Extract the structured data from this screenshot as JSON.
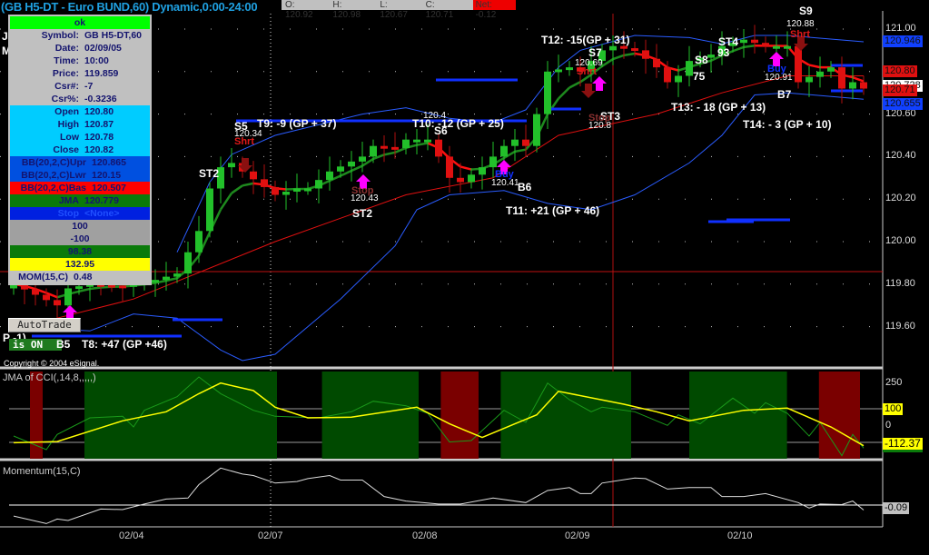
{
  "header": {
    "title": "(GB H5-DT - Euro BUND,60) Dynamic,0:00-24:00",
    "open": "O: 120.92",
    "high": "H: 120.98",
    "low": "L: 120.67",
    "close": "C: 120.71",
    "net": "Net: -0.12"
  },
  "data_window": {
    "ok": "ok",
    "rows": [
      {
        "k": "Symbol:",
        "v": "GB H5-DT,60"
      },
      {
        "k": "Date:",
        "v": "02/09/05"
      },
      {
        "k": "Time:",
        "v": "10:00"
      },
      {
        "k": "Price:",
        "v": "119.859"
      },
      {
        "k": "Csr#:",
        "v": "-7"
      },
      {
        "k": "Csr%:",
        "v": "-0.3236"
      },
      {
        "k": "Open",
        "v": "120.80"
      },
      {
        "k": "High",
        "v": "120.87"
      },
      {
        "k": "Low",
        "v": "120.78"
      },
      {
        "k": "Close",
        "v": "120.82"
      },
      {
        "k": "BB(20,2,C)Upr",
        "v": "120.865"
      },
      {
        "k": "BB(20,2,C)Lwr",
        "v": "120.15"
      },
      {
        "k": "BB(20,2,C)Bas",
        "v": "120.507"
      },
      {
        "k": "JMA",
        "v": "120.779"
      },
      {
        "k": "Stop",
        "v": "<None>"
      },
      {
        "k": "",
        "v": "100"
      },
      {
        "k": "",
        "v": "-100"
      },
      {
        "k": "",
        "v": "98.38"
      },
      {
        "k": "",
        "v": "132.95"
      },
      {
        "k": "MOM(15,C)",
        "v": "0.48"
      }
    ]
  },
  "left_labels": {
    "j": "J",
    "m": "M",
    "p": "P -1)",
    "autotrade": "AutoTrade",
    "is_on": "is ON",
    "copyright": "Copyright © 2004 eSignal."
  },
  "annotations": [
    "S5",
    "120.34",
    "T9: -9 (GP + 37)",
    "ST2",
    "T10: -12 (GP + 25)",
    "S6",
    "120.4",
    "120.43",
    "ST2",
    "120.41",
    "B6",
    "T11: +21 (GP + 46)",
    "T12: -15(GP + 31)",
    "S7",
    "120.69",
    "ST3",
    "120.8",
    "S8",
    "75",
    "ST4",
    "93",
    "T13: - 18 (GP + 13)",
    "120.91",
    "B7",
    "T14: - 3 (GP + 10)",
    "S9",
    "120.88",
    "B5",
    "T8: +47 (GP +46)"
  ],
  "signals": {
    "short": "Shrt",
    "stop": "Stop",
    "buy": "Buy"
  },
  "price_axis": {
    "ticks": [
      "121.00",
      "120.80",
      "120.60",
      "120.40",
      "120.20",
      "120.00",
      "119.80",
      "119.60"
    ],
    "tags": {
      "upper": "120.946",
      "mid": "120.80",
      "last": "120.71",
      "lower": "120.655",
      "cur": "120.728"
    }
  },
  "cci_panel": {
    "title": "JMA of CCI(,14,8,,,,,)",
    "ticks": [
      "250",
      "100",
      "0"
    ],
    "tag_100": "100",
    "value": "-112.37"
  },
  "mom_panel": {
    "title": "Momentum(15,C)",
    "value": "-0.09"
  },
  "dates": [
    "02/04",
    "02/07",
    "02/08",
    "02/09",
    "02/10"
  ],
  "colors": {
    "up": "#22c02a",
    "down": "#e01010",
    "band": "#2255ff",
    "jma_up": "#1e8a1e",
    "jma_down": "#ff1010",
    "cci_green": "#004a00",
    "cci_red": "#7a0000"
  },
  "chart_data": [
    {
      "type": "candlestick",
      "title": "GB H5-DT - Euro BUND,60",
      "ylim": [
        119.4,
        121.06
      ],
      "closes": [
        [
          0,
          119.8
        ],
        [
          2,
          119.75
        ],
        [
          4,
          119.7
        ],
        [
          5,
          119.78
        ],
        [
          7,
          119.8
        ],
        [
          10,
          119.79
        ],
        [
          13,
          119.82
        ],
        [
          15,
          119.85
        ],
        [
          17,
          120.05
        ],
        [
          18,
          120.25
        ],
        [
          19,
          120.35
        ],
        [
          20,
          120.37
        ],
        [
          21,
          120.33
        ],
        [
          24,
          120.22
        ],
        [
          26,
          120.25
        ],
        [
          27,
          120.25
        ],
        [
          29,
          120.33
        ],
        [
          32,
          120.4
        ],
        [
          33,
          120.45
        ],
        [
          35,
          120.44
        ],
        [
          36,
          120.48
        ],
        [
          38,
          120.48
        ],
        [
          39,
          120.4
        ],
        [
          40,
          120.3
        ],
        [
          41,
          120.28
        ],
        [
          43,
          120.35
        ],
        [
          45,
          120.45
        ],
        [
          46,
          120.48
        ],
        [
          47,
          120.45
        ],
        [
          48,
          120.6
        ],
        [
          49,
          120.8
        ],
        [
          51,
          120.82
        ],
        [
          52,
          120.8
        ],
        [
          54,
          120.9
        ],
        [
          55,
          120.92
        ],
        [
          57,
          120.9
        ],
        [
          59,
          120.82
        ],
        [
          60,
          120.75
        ],
        [
          61,
          120.78
        ],
        [
          62,
          120.85
        ],
        [
          64,
          120.88
        ],
        [
          65,
          120.92
        ],
        [
          67,
          120.95
        ],
        [
          69,
          120.92
        ],
        [
          71,
          120.92
        ],
        [
          72,
          120.75
        ],
        [
          74,
          120.8
        ],
        [
          75,
          120.82
        ],
        [
          76,
          120.72
        ],
        [
          77,
          120.75
        ],
        [
          78,
          120.72
        ]
      ],
      "bb_upper": [
        [
          15,
          119.95
        ],
        [
          18,
          120.28
        ],
        [
          20,
          120.41
        ],
        [
          24,
          120.5
        ],
        [
          32,
          120.6
        ],
        [
          36,
          120.63
        ],
        [
          40,
          120.58
        ],
        [
          44,
          120.56
        ],
        [
          47,
          120.62
        ],
        [
          50,
          120.82
        ],
        [
          52,
          120.9
        ],
        [
          57,
          120.97
        ],
        [
          62,
          120.96
        ],
        [
          65,
          120.93
        ],
        [
          68,
          120.97
        ],
        [
          71,
          120.97
        ],
        [
          78,
          120.94
        ]
      ],
      "bb_lower": [
        [
          0,
          119.6
        ],
        [
          7,
          119.58
        ],
        [
          11,
          119.66
        ],
        [
          15,
          119.64
        ],
        [
          19,
          119.49
        ],
        [
          21,
          119.44
        ],
        [
          24,
          119.47
        ],
        [
          30,
          119.73
        ],
        [
          35,
          119.98
        ],
        [
          37,
          120.15
        ],
        [
          40,
          120.22
        ],
        [
          45,
          120.24
        ],
        [
          49,
          120.18
        ],
        [
          53,
          120.15
        ],
        [
          57,
          120.22
        ],
        [
          62,
          120.37
        ],
        [
          65,
          120.5
        ],
        [
          68,
          120.69
        ],
        [
          71,
          120.7
        ],
        [
          78,
          120.67
        ]
      ],
      "bb_basis": [
        [
          4,
          119.64
        ],
        [
          11,
          119.73
        ],
        [
          24,
          120.0
        ],
        [
          36,
          120.22
        ],
        [
          44,
          120.3
        ],
        [
          50,
          120.5
        ],
        [
          59,
          120.6
        ],
        [
          65,
          120.7
        ],
        [
          71,
          120.78
        ],
        [
          78,
          120.78
        ]
      ],
      "cursor_price": 119.859
    },
    {
      "type": "line",
      "title": "JMA of CCI(,14,8,,,,,)",
      "ylim": [
        -160,
        290
      ],
      "levels": [
        100,
        -100
      ],
      "jma": [
        [
          0,
          -102
        ],
        [
          4,
          -95
        ],
        [
          10,
          28
        ],
        [
          14,
          82
        ],
        [
          17,
          190
        ],
        [
          19,
          253
        ],
        [
          22,
          208
        ],
        [
          24,
          109
        ],
        [
          27,
          46
        ],
        [
          31,
          50
        ],
        [
          37,
          109
        ],
        [
          40,
          10
        ],
        [
          43,
          -71
        ],
        [
          46,
          10
        ],
        [
          48,
          64
        ],
        [
          50,
          204
        ],
        [
          56,
          127
        ],
        [
          59,
          82
        ],
        [
          62,
          28
        ],
        [
          67,
          91
        ],
        [
          71,
          104
        ],
        [
          75,
          -8
        ],
        [
          78,
          -120
        ]
      ],
      "cci": [
        [
          0,
          -62
        ],
        [
          3,
          -143
        ],
        [
          4,
          -53
        ],
        [
          7,
          46
        ],
        [
          10,
          55
        ],
        [
          11,
          -8
        ],
        [
          12,
          91
        ],
        [
          15,
          172
        ],
        [
          17,
          289
        ],
        [
          19,
          190
        ],
        [
          22,
          91
        ],
        [
          24,
          55
        ],
        [
          28,
          46
        ],
        [
          31,
          82
        ],
        [
          33,
          145
        ],
        [
          36,
          118
        ],
        [
          38,
          73
        ],
        [
          40,
          -98
        ],
        [
          42,
          -89
        ],
        [
          45,
          91
        ],
        [
          47,
          19
        ],
        [
          49,
          253
        ],
        [
          51,
          154
        ],
        [
          53,
          82
        ],
        [
          54,
          109
        ],
        [
          57,
          82
        ],
        [
          60,
          1
        ],
        [
          61,
          64
        ],
        [
          63,
          10
        ],
        [
          66,
          163
        ],
        [
          68,
          73
        ],
        [
          69,
          136
        ],
        [
          71,
          73
        ],
        [
          73,
          -62
        ],
        [
          74,
          19
        ],
        [
          76,
          -179
        ],
        [
          77,
          -53
        ],
        [
          78,
          -134
        ]
      ],
      "zones": [
        {
          "from": 2,
          "to": 3,
          "color": "red"
        },
        {
          "from": 7,
          "to": 24.5
        },
        {
          "from": 28.8,
          "to": 37.5
        },
        {
          "from": 39.7,
          "to": 43
        },
        {
          "from": 45.2,
          "to": 57
        },
        {
          "from": 62.5,
          "to": 71.3
        },
        {
          "from": 74.4,
          "to": 78
        }
      ],
      "zone_colors": [
        "red",
        "green",
        "green",
        "red",
        "green",
        "green",
        "red"
      ]
    },
    {
      "type": "line",
      "title": "Momentum(15,C)",
      "ylim": [
        -0.9,
        2.8
      ],
      "values": [
        [
          0,
          -0.22
        ],
        [
          3,
          -0.37
        ],
        [
          4,
          -0.28
        ],
        [
          5,
          -0.31
        ],
        [
          8,
          -0.08
        ],
        [
          10,
          -0.09
        ],
        [
          12,
          0.02
        ],
        [
          14,
          0.12
        ],
        [
          16,
          0.14
        ],
        [
          17,
          0.41
        ],
        [
          19,
          0.74
        ],
        [
          21,
          0.62
        ],
        [
          22,
          0.59
        ],
        [
          24,
          0.44
        ],
        [
          26,
          0.47
        ],
        [
          27,
          0.53
        ],
        [
          29,
          0.59
        ],
        [
          30,
          0.5
        ],
        [
          32,
          0.5
        ],
        [
          34,
          0.17
        ],
        [
          36,
          0.08
        ],
        [
          39,
          0.02
        ],
        [
          41,
          0.02
        ],
        [
          44,
          0.14
        ],
        [
          47,
          0.05
        ],
        [
          49,
          0.29
        ],
        [
          51,
          0.35
        ],
        [
          52,
          0.23
        ],
        [
          53,
          0.23
        ],
        [
          54,
          0.44
        ],
        [
          57,
          0.54
        ],
        [
          58,
          0.53
        ],
        [
          60,
          0.32
        ],
        [
          62,
          0.35
        ],
        [
          64,
          0.35
        ],
        [
          65,
          0.17
        ],
        [
          67,
          0.17
        ],
        [
          69,
          0.23
        ],
        [
          72,
          0.05
        ],
        [
          73,
          -0.06
        ],
        [
          74,
          0.02
        ],
        [
          76,
          0.01
        ],
        [
          77,
          0.08
        ],
        [
          78,
          -0.1
        ]
      ]
    }
  ]
}
